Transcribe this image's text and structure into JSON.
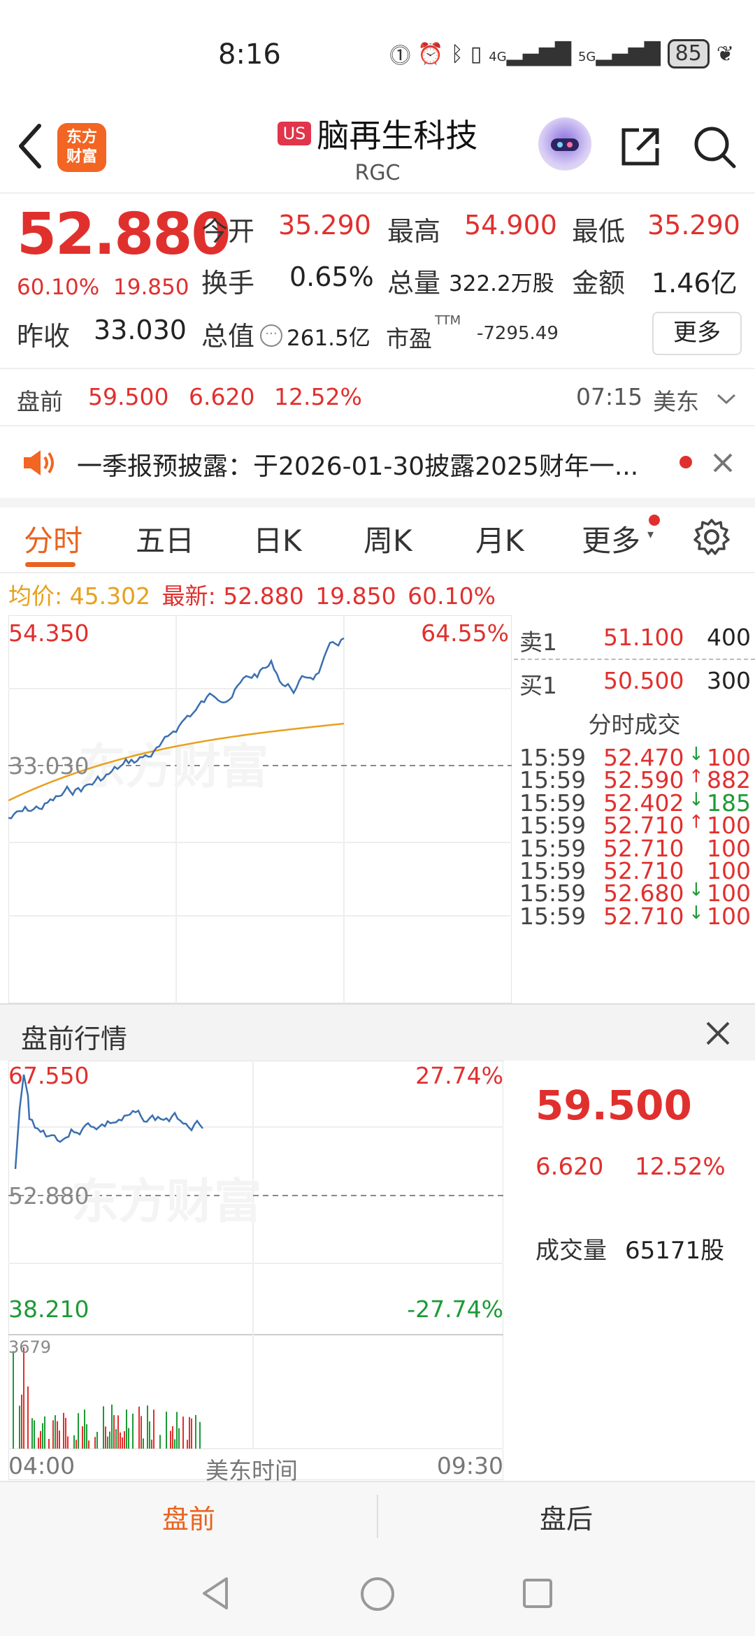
{
  "status_bar": {
    "time": "8:16",
    "battery": "85",
    "signal1": "4G",
    "signal2": "5G"
  },
  "header": {
    "logo_text": "东方财富",
    "market_badge": "US",
    "stock_name": "脑再生科技",
    "stock_code": "RGC"
  },
  "quote": {
    "price": "52.880",
    "change_pct": "60.10%",
    "change": "19.850",
    "open_label": "今开",
    "open": "35.290",
    "high_label": "最高",
    "high": "54.900",
    "low_label": "最低",
    "low": "35.290",
    "turnover_label": "换手",
    "turnover": "0.65%",
    "volume_label": "总量",
    "volume": "322.2万股",
    "amount_label": "金额",
    "amount": "1.46亿",
    "prev_close_label": "昨收",
    "prev_close": "33.030",
    "mktcap_label": "总值",
    "mktcap": "261.5亿",
    "pe_label": "市盈",
    "pe_sup": "TTM",
    "pe": "-7295.49",
    "more_label": "更多"
  },
  "premarket_row": {
    "label": "盘前",
    "price": "59.500",
    "change": "6.620",
    "pct": "12.52%",
    "time": "07:15",
    "tz": "美东"
  },
  "notice": {
    "text": "一季报预披露：于2026-01-30披露2025财年一..."
  },
  "tabs": [
    "分时",
    "五日",
    "日K",
    "周K",
    "月K",
    "更多"
  ],
  "avg_line": {
    "avg_label": "均价:",
    "avg": "45.302",
    "latest_label": "最新:",
    "latest": "52.880",
    "change": "19.850",
    "pct": "60.10%"
  },
  "main_chart": {
    "top_price": "54.350",
    "top_pct": "64.55%",
    "base_price": "33.030",
    "watermark": "东方财富"
  },
  "order_book": [
    {
      "label": "卖1",
      "price": "51.100",
      "qty": "400"
    },
    {
      "label": "买1",
      "price": "50.500",
      "qty": "300"
    }
  ],
  "trades": {
    "title": "分时成交",
    "rows": [
      {
        "time": "15:59",
        "price": "52.470",
        "dir": "down",
        "vol": "100",
        "vol_color": "red"
      },
      {
        "time": "15:59",
        "price": "52.590",
        "dir": "up",
        "vol": "882",
        "vol_color": "red"
      },
      {
        "time": "15:59",
        "price": "52.402",
        "dir": "down",
        "vol": "185",
        "vol_color": "green"
      },
      {
        "time": "15:59",
        "price": "52.710",
        "dir": "up",
        "vol": "100",
        "vol_color": "red"
      },
      {
        "time": "15:59",
        "price": "52.710",
        "dir": "",
        "vol": "100",
        "vol_color": "red"
      },
      {
        "time": "15:59",
        "price": "52.710",
        "dir": "",
        "vol": "100",
        "vol_color": "red"
      },
      {
        "time": "15:59",
        "price": "52.680",
        "dir": "down",
        "vol": "100",
        "vol_color": "red"
      },
      {
        "time": "15:59",
        "price": "52.710",
        "dir": "down",
        "vol": "100",
        "vol_color": "red"
      }
    ]
  },
  "premarket_panel": {
    "title": "盘前行情",
    "top_price": "67.550",
    "top_pct": "27.74%",
    "mid_price": "52.880",
    "bottom_price": "38.210",
    "bottom_pct": "-27.74%",
    "vol_max": "3679",
    "x_start": "04:00",
    "x_mid": "美东时间",
    "x_end": "09:30",
    "price": "59.500",
    "change": "6.620",
    "pct": "12.52%",
    "volume_label": "成交量",
    "volume": "65171股",
    "watermark": "东方财富"
  },
  "bottom_tabs": [
    "盘前",
    "盘后"
  ],
  "colors": {
    "up": "#e0302e",
    "down": "#1d9a36",
    "accent": "#e86420",
    "line": "#3a6fb0",
    "avg": "#e8a01c"
  }
}
